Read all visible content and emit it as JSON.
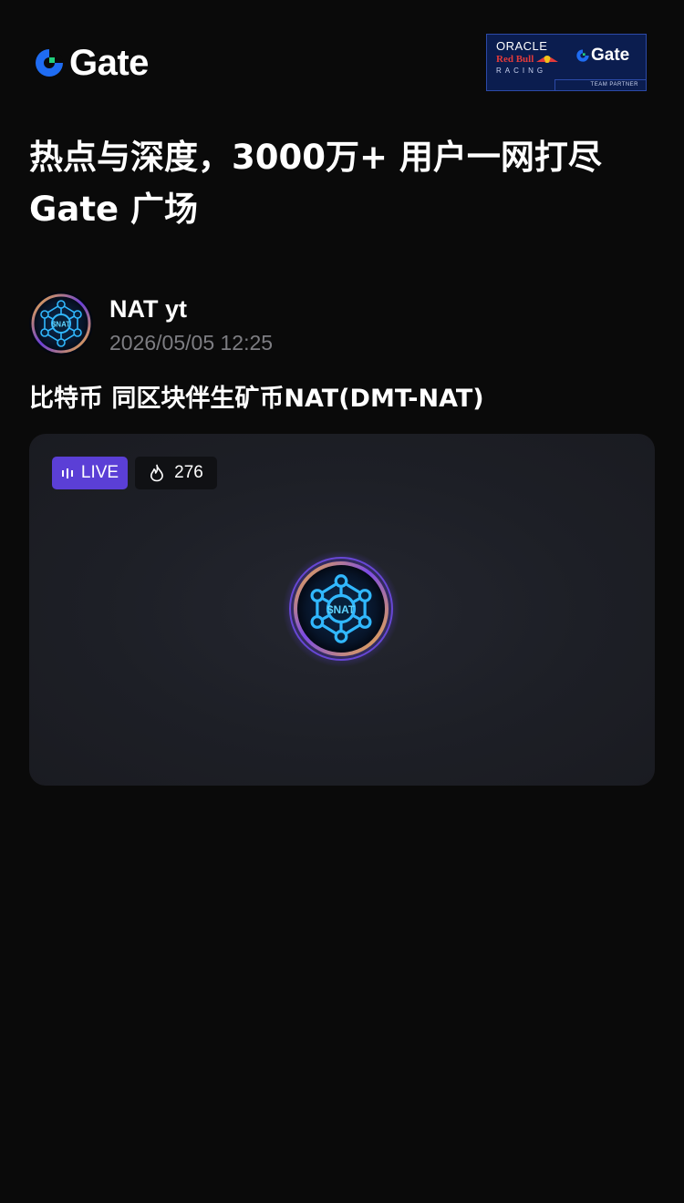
{
  "header": {
    "logo_text": "Gate",
    "partner": {
      "oracle": "ORACLE",
      "redbull": "Red Bull",
      "racing": "RACING",
      "gate": "Gate",
      "team_partner": "TEAM PARTNER"
    }
  },
  "headline": {
    "line1": "热点与深度，3000万+ 用户一网打尽",
    "line2": "Gate 广场"
  },
  "post": {
    "author": "NAT yt",
    "timestamp": "2026/05/05 12:25",
    "avatar_label": "$NAT",
    "title": "比特币 同区块伴生矿币NAT(DMT-NAT)"
  },
  "live": {
    "badge_label": "LIVE",
    "viewers": "276",
    "host_avatar_label": "$NAT"
  },
  "icons": {
    "logo": "gate-logo-icon",
    "live": "live-bars-icon",
    "heat": "flame-icon",
    "avatar": "nat-token-icon"
  },
  "colors": {
    "background": "#0a0a0a",
    "brand_blue": "#1f6cf2",
    "brand_green": "#1fd07d",
    "live_purple": "#5b3fd6",
    "muted_text": "#7d7d82",
    "card_bg": "#1d1f26",
    "partner_navy": "#0b1d4f"
  }
}
